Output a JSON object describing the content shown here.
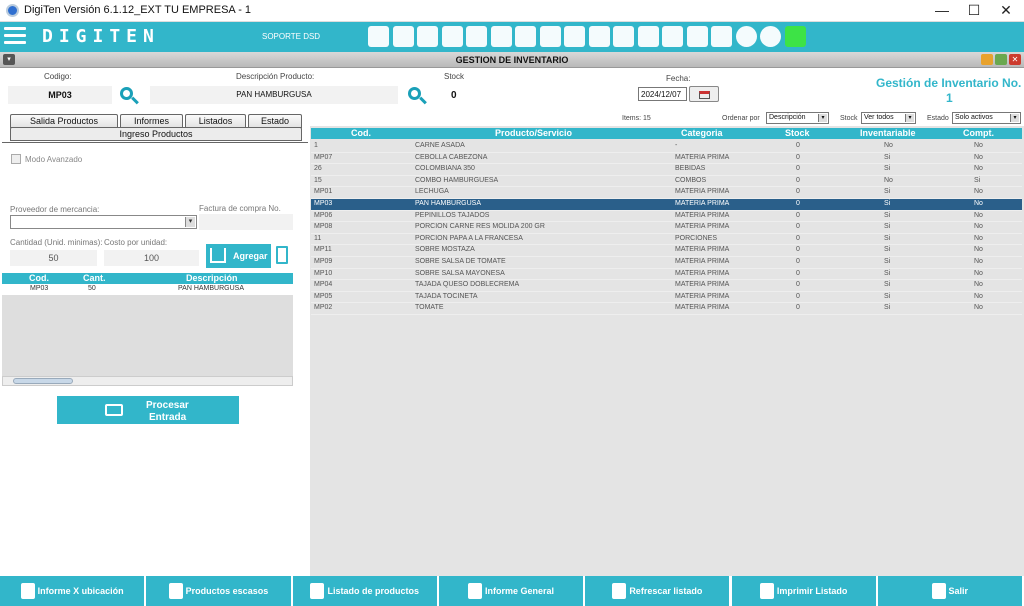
{
  "window": {
    "title": "DigiTen Versión 6.1.12_EXT TU EMPRESA - 1",
    "minimize": "—",
    "maximize": "☐",
    "close": "✕"
  },
  "toolbar": {
    "logo": "DIGITEN",
    "soporte": "SOPORTE DSD",
    "icons": [
      "cash-register-icon",
      "gift-icon",
      "user-shield-icon",
      "price-tag-icon",
      "cart-add-icon",
      "document-icon",
      "cart-check-icon",
      "box-icon",
      "list-document-icon",
      "document-add-icon",
      "document-list-icon",
      "handshake-icon",
      "bar-chart-icon",
      "users-icon",
      "calendar-user-icon",
      "gear-icon",
      "help-icon",
      "pencil-icon"
    ]
  },
  "gestion": {
    "title": "GESTION DE INVENTARIO",
    "heading": "Gestión de Inventario No.",
    "number": "1"
  },
  "form": {
    "codigo_label": "Codigo:",
    "codigo": "MP03",
    "desc_label": "Descripción Producto:",
    "desc": "PAN HAMBURGUSA",
    "stock_label": "Stock",
    "stock": "0",
    "fecha_label": "Fecha:",
    "fecha": "2024/12/07"
  },
  "tabs": {
    "salida": "Salida Productos",
    "informes": "Informes",
    "listados": "Listados",
    "estado": "Estado",
    "ingreso": "Ingreso Productos"
  },
  "entrada": {
    "modo_avanzado": "Modo Avanzado",
    "proveedor_label": "Proveedor de mercancia:",
    "factura_label": "Factura de compra No.",
    "cantidad_label": "Cantidad (Unid. minimas):",
    "cantidad": "50",
    "costo_label": "Costo por unidad:",
    "costo": "100",
    "agregar": "Agregar",
    "cols": [
      "Cod.",
      "Cant.",
      "Descripción"
    ],
    "rows": [
      [
        "MP03",
        "50",
        "PAN HAMBURGUSA"
      ]
    ],
    "procesar_1": "Procesar",
    "procesar_2": "Entrada"
  },
  "list": {
    "items_label": "Items: 15",
    "ordenar_label": "Ordenar por",
    "ordenar": "Descripción",
    "stock_label": "Stock",
    "stock": "Ver todos",
    "estado_label": "Estado",
    "estado": "Solo activos",
    "cols": [
      "Cod.",
      "Producto/Servicio",
      "Categoria",
      "Stock",
      "Inventariable",
      "Compt."
    ],
    "rows": [
      [
        "1",
        "CARNE ASADA",
        "-",
        "0",
        "No",
        "No"
      ],
      [
        "MP07",
        "CEBOLLA CABEZONA",
        "MATERIA PRIMA",
        "0",
        "Si",
        "No"
      ],
      [
        "26",
        "COLOMBIANA 350",
        "BEBIDAS",
        "0",
        "Si",
        "No"
      ],
      [
        "15",
        "COMBO HAMBURGUESA",
        "COMBOS",
        "0",
        "No",
        "Si"
      ],
      [
        "MP01",
        "LECHUGA",
        "MATERIA PRIMA",
        "0",
        "Si",
        "No"
      ],
      [
        "MP03",
        "PAN HAMBURGUSA",
        "MATERIA PRIMA",
        "0",
        "Si",
        "No"
      ],
      [
        "MP06",
        "PEPINILLOS TAJADOS",
        "MATERIA PRIMA",
        "0",
        "Si",
        "No"
      ],
      [
        "MP08",
        "PORCION CARNE RES MOLIDA 200 GR",
        "MATERIA PRIMA",
        "0",
        "Si",
        "No"
      ],
      [
        "11",
        "PORCION PAPA A LA FRANCESA",
        "PORCIONES",
        "0",
        "Si",
        "No"
      ],
      [
        "MP11",
        "SOBRE MOSTAZA",
        "MATERIA PRIMA",
        "0",
        "Si",
        "No"
      ],
      [
        "MP09",
        "SOBRE SALSA DE TOMATE",
        "MATERIA PRIMA",
        "0",
        "Si",
        "No"
      ],
      [
        "MP10",
        "SOBRE SALSA MAYONESA",
        "MATERIA PRIMA",
        "0",
        "Si",
        "No"
      ],
      [
        "MP04",
        "TAJADA QUESO DOBLECREMA",
        "MATERIA PRIMA",
        "0",
        "Si",
        "No"
      ],
      [
        "MP05",
        "TAJADA TOCINETA",
        "MATERIA PRIMA",
        "0",
        "Si",
        "No"
      ],
      [
        "MP02",
        "TOMATE",
        "MATERIA PRIMA",
        "0",
        "Si",
        "No"
      ]
    ]
  },
  "bottom": [
    "Informe X ubicación",
    "Productos escasos",
    "Listado de productos",
    "Informe General",
    "Refrescar listado",
    "Imprimir Listado",
    "Salir"
  ],
  "colors": {
    "accent": "#32b6ca",
    "selected": "#2a5f8a"
  }
}
